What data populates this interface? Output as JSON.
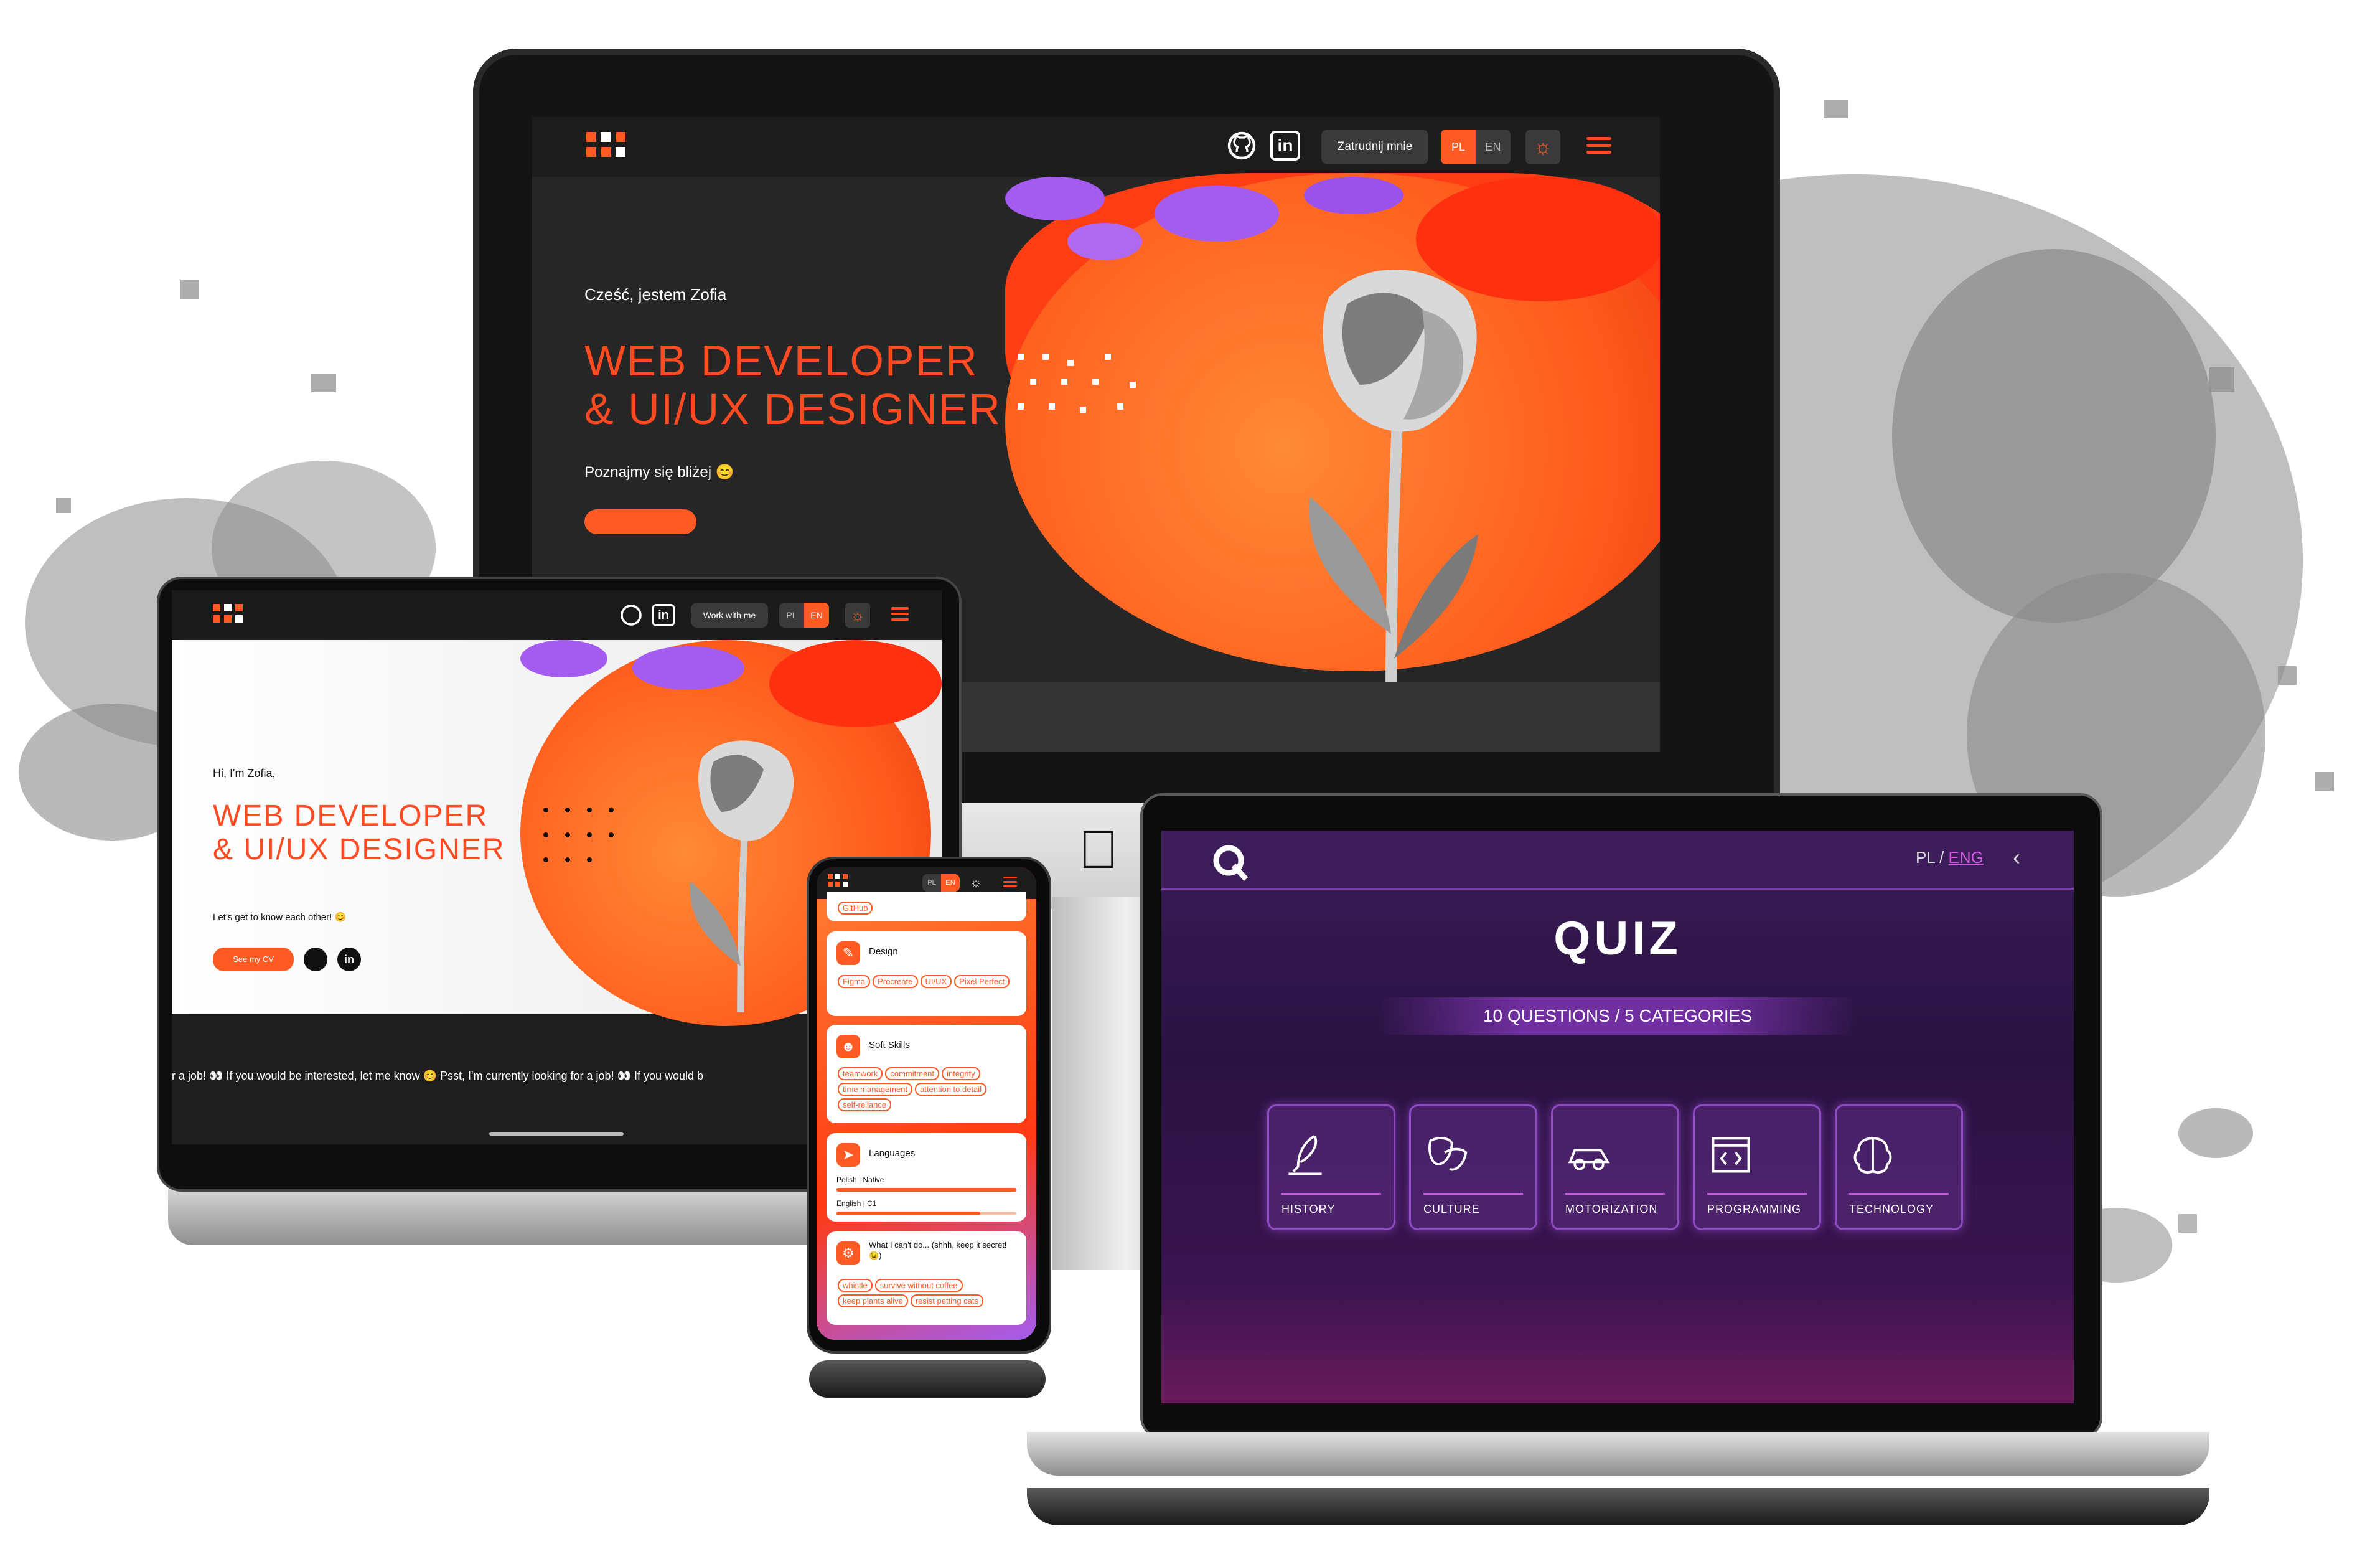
{
  "desktop": {
    "nav": {
      "hire_label": "Zatrudnij mnie",
      "lang_pl": "PL",
      "lang_en": "EN"
    },
    "hero": {
      "greeting": "Cześć, jestem Zofia",
      "title_line1": "WEB DEVELOPER",
      "title_line2": "& UI/UX DESIGNER",
      "subtitle": "Poznajmy się bliżej 😊"
    }
  },
  "tablet": {
    "nav": {
      "work_label": "Work with me",
      "lang_pl": "PL",
      "lang_en": "EN"
    },
    "hero": {
      "greeting": "Hi, I'm Zofia,",
      "title_line1": "WEB DEVELOPER",
      "title_line2": "& UI/UX DESIGNER",
      "subtitle": "Let's get to know each other! 😊",
      "cv_label": "See my CV"
    },
    "ticker": "r a job! 👀 If you would be interested, let me know 😊        Psst, I'm currently looking for a job! 👀 If you would b"
  },
  "phone": {
    "nav": {
      "lang_pl": "PL",
      "lang_en": "EN"
    },
    "top_chip": "GitHub",
    "cards": [
      {
        "title": "Design",
        "chips": [
          "Figma",
          "Procreate",
          "UI/UX",
          "Pixel Perfect"
        ]
      },
      {
        "title": "Soft Skills",
        "chips": [
          "teamwork",
          "commitment",
          "integrity",
          "time management",
          "attention to detail",
          "self-reliance"
        ]
      },
      {
        "title": "Languages",
        "rows": [
          {
            "label": "Polish | Native",
            "level": 1.0
          },
          {
            "label": "English | C1",
            "level": 0.8
          }
        ]
      },
      {
        "title": "What I can't do... (shhh, keep it secret! 😉)",
        "chips": [
          "whistle",
          "survive without coffee",
          "keep plants alive",
          "resist petting cats"
        ]
      }
    ]
  },
  "laptop": {
    "lang": {
      "pl": "PL",
      "sep": "/",
      "eng": "ENG"
    },
    "title": "QUIZ",
    "subtitle": "10 QUESTIONS / 5 CATEGORIES",
    "categories": [
      {
        "label": "HISTORY",
        "icon": "quill-icon"
      },
      {
        "label": "CULTURE",
        "icon": "theater-masks-icon"
      },
      {
        "label": "MOTORIZATION",
        "icon": "car-icon"
      },
      {
        "label": "PROGRAMMING",
        "icon": "code-window-icon"
      },
      {
        "label": "TECHNOLOGY",
        "icon": "brain-chip-icon"
      }
    ]
  },
  "colors": {
    "accent": "#ff5a24",
    "quiz_accent": "#c65be0",
    "quiz_bg": "#2a1342"
  }
}
